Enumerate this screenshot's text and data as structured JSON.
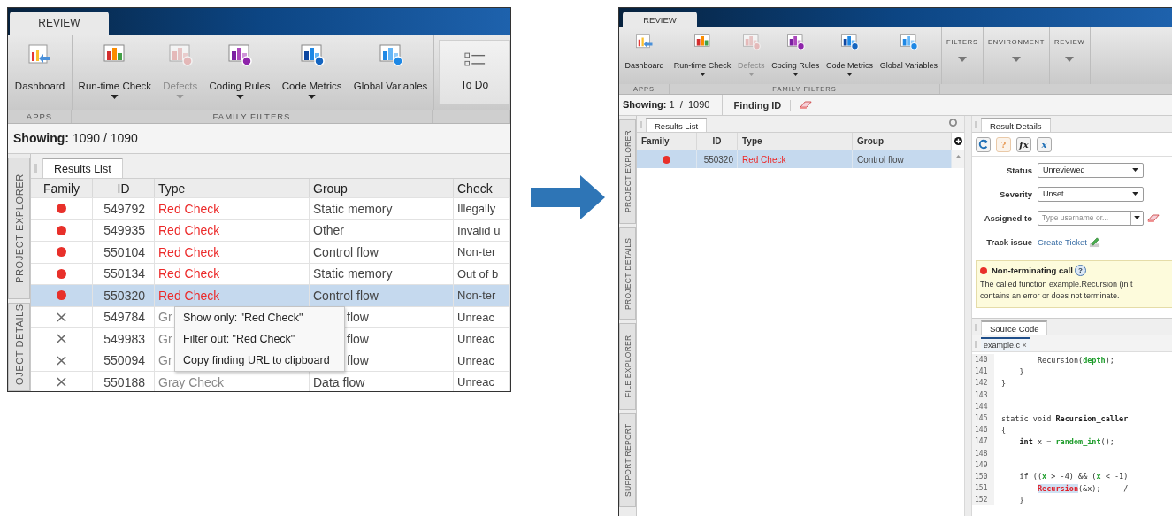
{
  "left": {
    "tab": "REVIEW",
    "toolbar": {
      "buttons": [
        {
          "label": "Dashboard",
          "disabled": false,
          "dropdown": false
        },
        {
          "label": "Run-time Check",
          "disabled": false,
          "dropdown": true
        },
        {
          "label": "Defects",
          "disabled": true,
          "dropdown": true
        },
        {
          "label": "Coding Rules",
          "disabled": false,
          "dropdown": true
        },
        {
          "label": "Code Metrics",
          "disabled": false,
          "dropdown": true
        },
        {
          "label": "Global Variables",
          "disabled": false,
          "dropdown": false
        }
      ],
      "todo": "To Do",
      "group_labels": [
        "APPS",
        "FAMILY FILTERS"
      ]
    },
    "showing": {
      "label": "Showing:",
      "value": "1090  /  1090"
    },
    "side_tabs": [
      "PROJECT EXPLORER",
      "OJECT DETAILS"
    ],
    "results_tab": "Results List",
    "columns": [
      "Family",
      "ID",
      "Type",
      "Group",
      "Check"
    ],
    "rows": [
      {
        "kind": "red",
        "id": "549792",
        "type": "Red Check",
        "group": "Static memory",
        "check": "Illegally",
        "selected": false
      },
      {
        "kind": "red",
        "id": "549935",
        "type": "Red Check",
        "group": "Other",
        "check": "Invalid u",
        "selected": false
      },
      {
        "kind": "red",
        "id": "550104",
        "type": "Red Check",
        "group": "Control flow",
        "check": "Non-ter",
        "selected": false
      },
      {
        "kind": "red",
        "id": "550134",
        "type": "Red Check",
        "group": "Static memory",
        "check": "Out of b",
        "selected": false
      },
      {
        "kind": "red",
        "id": "550320",
        "type": "Red Check",
        "group": "Control flow",
        "check": "Non-ter",
        "selected": true
      },
      {
        "kind": "gray",
        "id": "549784",
        "type": "Gr",
        "group": "flow",
        "check": "Unreac",
        "selected": false
      },
      {
        "kind": "gray",
        "id": "549983",
        "type": "Gr",
        "group": "flow",
        "check": "Unreac",
        "selected": false
      },
      {
        "kind": "gray",
        "id": "550094",
        "type": "Gr",
        "group": "flow",
        "check": "Unreac",
        "selected": false
      },
      {
        "kind": "gray",
        "id": "550188",
        "type": "Gray Check",
        "group": "Data flow",
        "check": "Unreac",
        "selected": false
      }
    ],
    "context_menu": [
      "Show only: \"Red Check\"",
      "Filter out: \"Red Check\"",
      "Copy finding URL to clipboard"
    ]
  },
  "right": {
    "tab": "REVIEW",
    "toolbar": {
      "buttons": [
        {
          "label": "Dashboard",
          "disabled": false,
          "dropdown": false
        },
        {
          "label": "Run-time Check",
          "disabled": false,
          "dropdown": true
        },
        {
          "label": "Defects",
          "disabled": true,
          "dropdown": true
        },
        {
          "label": "Coding Rules",
          "disabled": false,
          "dropdown": true
        },
        {
          "label": "Code Metrics",
          "disabled": false,
          "dropdown": true
        },
        {
          "label": "Global Variables",
          "disabled": false,
          "dropdown": false
        }
      ],
      "group_labels": [
        "APPS",
        "FAMILY FILTERS"
      ],
      "menus": [
        "FILTERS",
        "ENVIRONMENT",
        "REVIEW"
      ]
    },
    "showing": {
      "label": "Showing:",
      "value": "1  /  1090"
    },
    "finding_id": "Finding ID",
    "side_tabs": [
      "PROJECT EXPLORER",
      "PROJECT DETAILS",
      "FILE EXPLORER",
      "SUPPORT REPORT"
    ],
    "results_tab": "Results List",
    "columns": [
      "Family",
      "ID",
      "Type",
      "Group"
    ],
    "rows": [
      {
        "kind": "red",
        "id": "550320",
        "type": "Red Check",
        "group": "Control flow",
        "selected": true
      }
    ],
    "details": {
      "tab": "Result Details",
      "tools": [
        {
          "kind": "refresh",
          "disabled": false
        },
        {
          "kind": "glyph",
          "glyph": "?",
          "disabled": true
        },
        {
          "kind": "glyph",
          "glyph": "fx",
          "disabled": false
        },
        {
          "kind": "glyph",
          "glyph": "x",
          "disabled": false
        }
      ],
      "fields": [
        {
          "label": "Status",
          "kind": "select",
          "value": "Unreviewed"
        },
        {
          "label": "Severity",
          "kind": "select",
          "value": "Unset"
        },
        {
          "label": "Assigned to",
          "kind": "combo",
          "placeholder": "Type username or..."
        }
      ],
      "track": {
        "label": "Track issue",
        "link": "Create Ticket"
      },
      "message": {
        "title": "Non-terminating call",
        "help": "?",
        "lines": [
          "The called function example.Recursion (in t",
          "contains an error or does not terminate."
        ]
      }
    },
    "source": {
      "tab": "Source Code",
      "file_tab": "example.c",
      "close": "×",
      "lines": [
        {
          "num": "140",
          "segments": [
            {
              "kind": "plain",
              "text": "        Recursion("
            },
            {
              "kind": "green",
              "text": "depth"
            },
            {
              "kind": "plain",
              "text": ");"
            }
          ]
        },
        {
          "num": "141",
          "segments": [
            {
              "kind": "plain",
              "text": "    }"
            }
          ]
        },
        {
          "num": "142",
          "segments": [
            {
              "kind": "plain",
              "text": "}"
            }
          ]
        },
        {
          "num": "143"
        },
        {
          "num": "144"
        },
        {
          "num": "145",
          "segments": [
            {
              "kind": "plain",
              "text": "static void "
            },
            {
              "kind": "bold",
              "text": "Recursion_caller"
            }
          ]
        },
        {
          "num": "146",
          "segments": [
            {
              "kind": "plain",
              "text": "{"
            }
          ]
        },
        {
          "num": "147",
          "segments": [
            {
              "kind": "bold",
              "text": "    int"
            },
            {
              "kind": "plain",
              "text": " x = "
            },
            {
              "kind": "green",
              "text": "random_int"
            },
            {
              "kind": "plain",
              "text": "();"
            }
          ]
        },
        {
          "num": "148"
        },
        {
          "num": "149"
        },
        {
          "num": "150",
          "segments": [
            {
              "kind": "plain",
              "text": "    if (("
            },
            {
              "kind": "green",
              "text": "x"
            },
            {
              "kind": "plain",
              "text": " > -4) && ("
            },
            {
              "kind": "green",
              "text": "x"
            },
            {
              "kind": "plain",
              "text": " < -1)"
            }
          ]
        },
        {
          "num": "151",
          "kind": "indent-deep",
          "segments": [
            {
              "kind": "error",
              "text": "Recursion"
            },
            {
              "kind": "plain",
              "text": "(&x);     /"
            }
          ]
        },
        {
          "num": "152",
          "segments": [
            {
              "kind": "plain",
              "text": "    }"
            }
          ]
        }
      ]
    }
  }
}
